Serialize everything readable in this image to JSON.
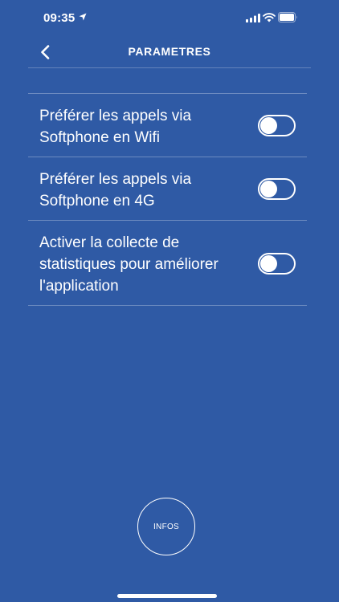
{
  "status_bar": {
    "time": "09:35",
    "icons": [
      "location-arrow-icon",
      "cellular-signal-icon",
      "wifi-icon",
      "battery-icon"
    ]
  },
  "header": {
    "title": "PARAMETRES",
    "back_icon": "chevron-left-icon"
  },
  "settings": [
    {
      "label": "Préférer les appels via Softphone en Wifi",
      "enabled": false
    },
    {
      "label": "Préférer les appels via Softphone en 4G",
      "enabled": false
    },
    {
      "label": "Activer la collecte de statistiques pour améliorer l'application",
      "enabled": false
    }
  ],
  "infos_button": {
    "label": "INFOS"
  },
  "colors": {
    "background": "#2f5aa5",
    "foreground": "#ffffff"
  }
}
